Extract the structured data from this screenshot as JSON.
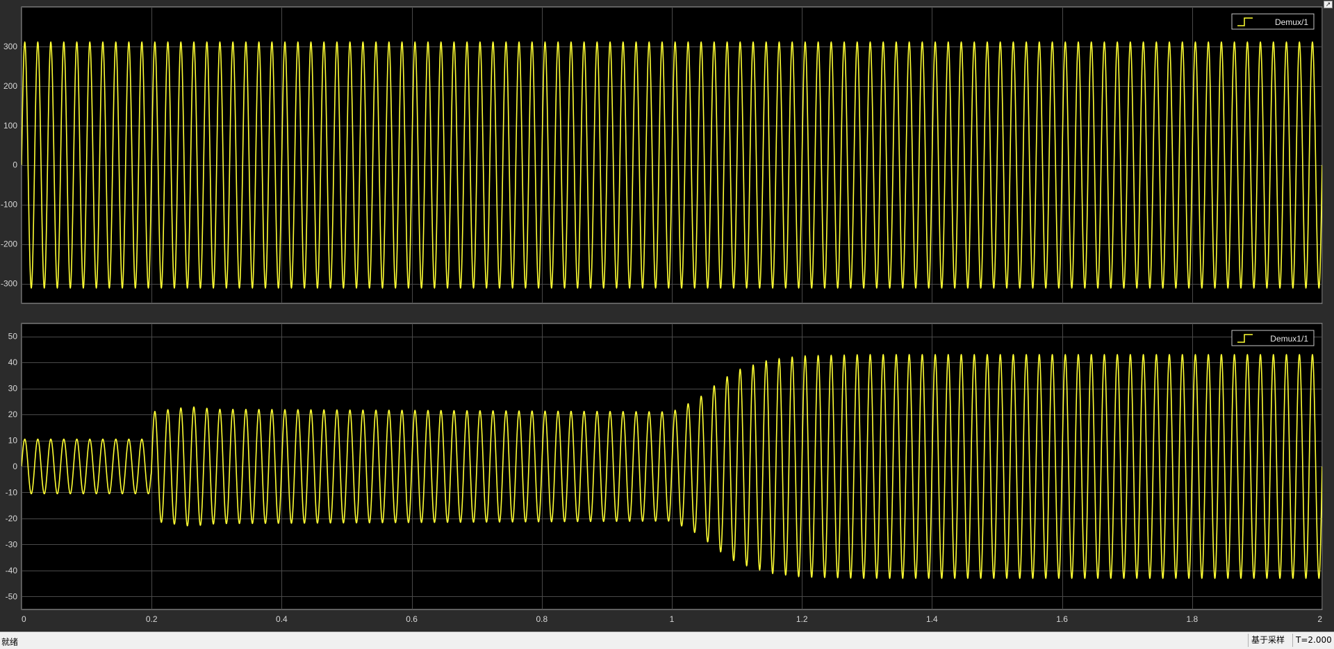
{
  "window": {
    "corner_icon": "restore-icon",
    "status": "就绪",
    "mode": "基于采样",
    "time": "T=2.000"
  },
  "colors": {
    "background": "#2b2b2b",
    "plot_background": "#000000",
    "grid": "#4a4a4a",
    "axes_border": "#a8a8a8",
    "trace": "#ffff33",
    "tick_label": "#d8d8d8"
  },
  "chart_data": [
    {
      "type": "line",
      "title": "",
      "xlabel": "",
      "ylabel": "",
      "xlim": [
        0,
        2
      ],
      "ylim": [
        -350,
        400
      ],
      "x_ticks": [
        0,
        0.2,
        0.4,
        0.6,
        0.8,
        1,
        1.2,
        1.4,
        1.6,
        1.8,
        2
      ],
      "x_tick_labels": [],
      "y_ticks": [
        300,
        200,
        100,
        0,
        -100,
        -200,
        -300
      ],
      "y_tick_labels": [
        "300",
        "200",
        "100",
        "0",
        "-100",
        "-200",
        "-300"
      ],
      "grid": true,
      "legend": "top-right",
      "series": [
        {
          "name": "Demux/1",
          "waveform": "sine",
          "frequency_hz": 50,
          "envelope": [
            [
              0,
              311
            ],
            [
              2,
              311
            ]
          ]
        }
      ]
    },
    {
      "type": "line",
      "title": "",
      "xlabel": "",
      "ylabel": "",
      "xlim": [
        0,
        2
      ],
      "ylim": [
        -55,
        55
      ],
      "x_ticks": [
        0,
        0.2,
        0.4,
        0.6,
        0.8,
        1,
        1.2,
        1.4,
        1.6,
        1.8,
        2
      ],
      "x_tick_labels": [
        "0",
        "0.2",
        "0.4",
        "0.6",
        "0.8",
        "1",
        "1.2",
        "1.4",
        "1.6",
        "1.8",
        "2"
      ],
      "y_ticks": [
        50,
        40,
        30,
        20,
        10,
        0,
        -10,
        -20,
        -30,
        -40,
        -50
      ],
      "y_tick_labels": [
        "50",
        "40",
        "30",
        "20",
        "10",
        "0",
        "-10",
        "-20",
        "-30",
        "-40",
        "-50"
      ],
      "grid": true,
      "legend": "top-right",
      "series": [
        {
          "name": "Demux1/1",
          "waveform": "sine",
          "frequency_hz": 50,
          "envelope": [
            [
              0,
              10.5
            ],
            [
              0.199,
              10.5
            ],
            [
              0.2,
              21
            ],
            [
              0.26,
              23
            ],
            [
              0.3,
              22
            ],
            [
              1.0,
              21
            ],
            [
              1.04,
              26
            ],
            [
              1.07,
              32
            ],
            [
              1.1,
              37
            ],
            [
              1.15,
              41
            ],
            [
              1.2,
              42.5
            ],
            [
              1.3,
              43
            ],
            [
              2,
              43
            ]
          ]
        }
      ]
    }
  ]
}
